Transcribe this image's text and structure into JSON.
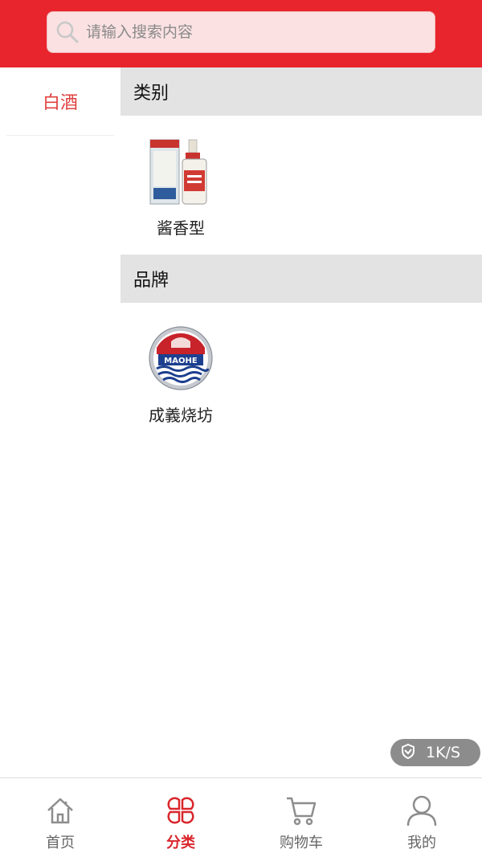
{
  "search": {
    "placeholder": "请输入搜索内容"
  },
  "sidebar": {
    "items": [
      {
        "label": "白酒",
        "active": true
      }
    ]
  },
  "sections": [
    {
      "title": "类别",
      "items": [
        {
          "label": "酱香型",
          "icon": "baijiu-bottle-image"
        }
      ]
    },
    {
      "title": "品牌",
      "items": [
        {
          "label": "成義烧坊",
          "icon": "brand-logo-image",
          "logo_text": "MAOHE"
        }
      ]
    }
  ],
  "network_speed": {
    "label": "1K/S"
  },
  "tabbar": {
    "tabs": [
      {
        "label": "首页",
        "icon": "home-icon",
        "active": false
      },
      {
        "label": "分类",
        "icon": "category-icon",
        "active": true
      },
      {
        "label": "购物车",
        "icon": "cart-icon",
        "active": false
      },
      {
        "label": "我的",
        "icon": "user-icon",
        "active": false
      }
    ]
  },
  "colors": {
    "accent": "#e8242d",
    "active_text": "#d9262c",
    "section_header_bg": "#e3e3e3"
  }
}
